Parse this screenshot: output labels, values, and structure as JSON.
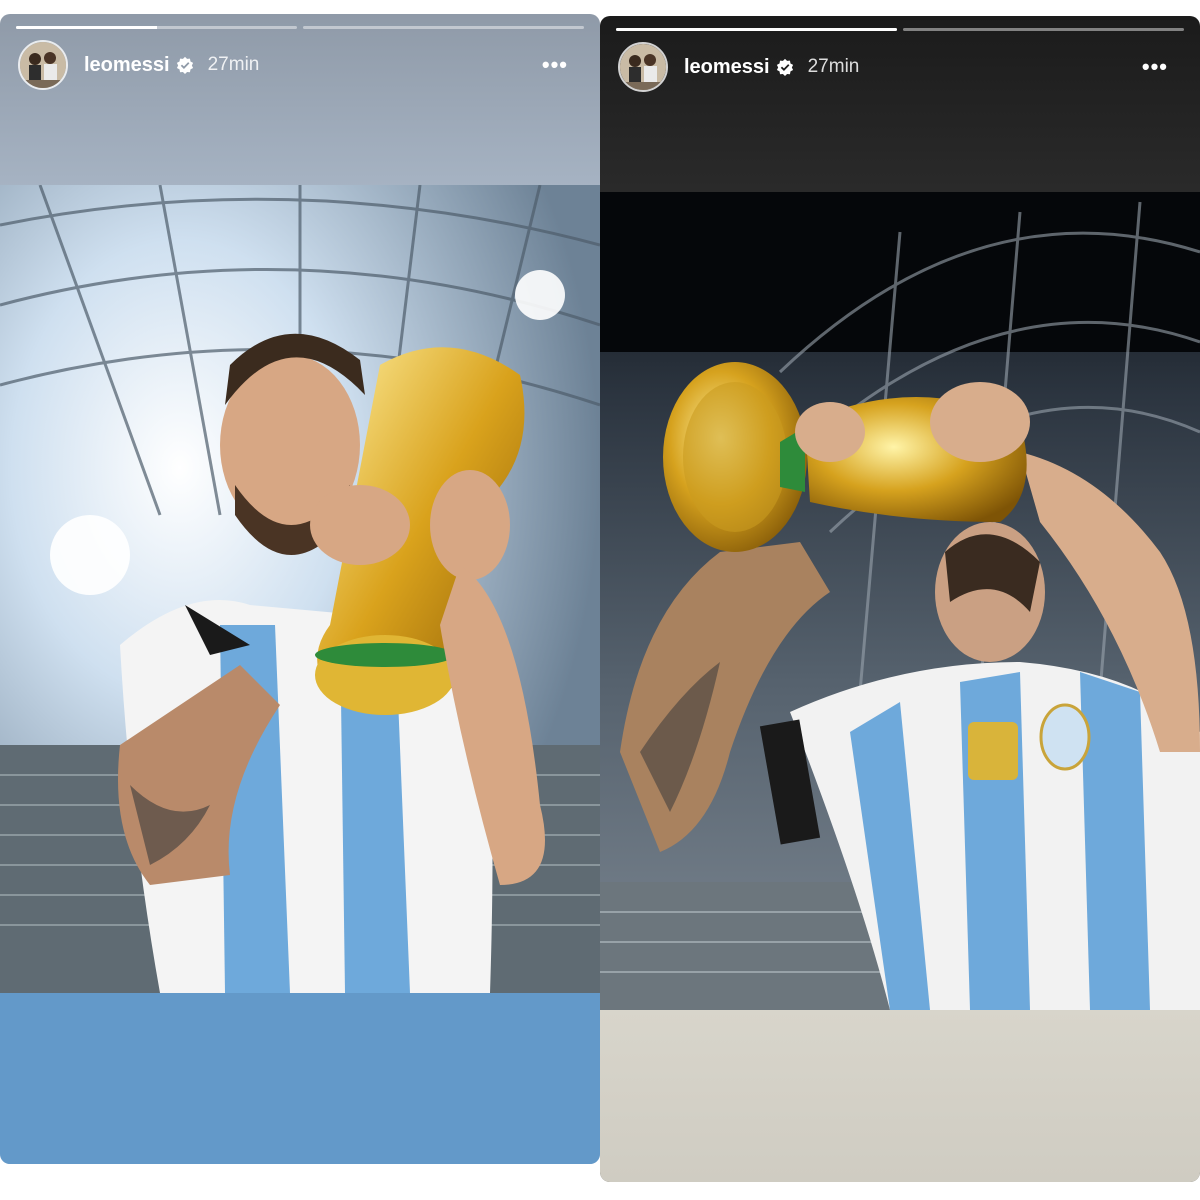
{
  "stories": [
    {
      "username": "leomessi",
      "time": "27min",
      "progress": [
        0.5,
        0
      ],
      "colors": {
        "bottom": "#6399c9"
      }
    },
    {
      "username": "leomessi",
      "time": "27min",
      "progress": [
        1,
        0
      ],
      "colors": {
        "bottom": "#d3d0c6"
      }
    }
  ],
  "icons": {
    "verified": "verified-badge-icon",
    "more": "more-options-icon"
  }
}
